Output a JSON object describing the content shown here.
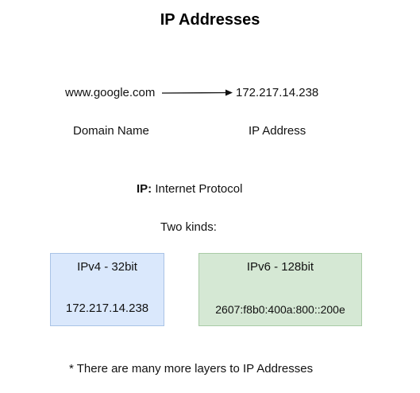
{
  "title": "IP Addresses",
  "mapping": {
    "domain_value": "www.google.com",
    "ip_value": "172.217.14.238",
    "domain_caption": "Domain Name",
    "ip_caption": "IP Address"
  },
  "protocol": {
    "label": "IP:",
    "text": " Internet Protocol"
  },
  "kinds_label": "Two kinds:",
  "kinds": [
    {
      "heading": "IPv4 - 32bit",
      "example": "172.217.14.238",
      "color": "#dae8fc"
    },
    {
      "heading": "IPv6 - 128bit",
      "example": "2607:f8b0:400a:800::200e",
      "color": "#d5e8d4"
    }
  ],
  "footnote": "* There are many more layers to IP Addresses"
}
